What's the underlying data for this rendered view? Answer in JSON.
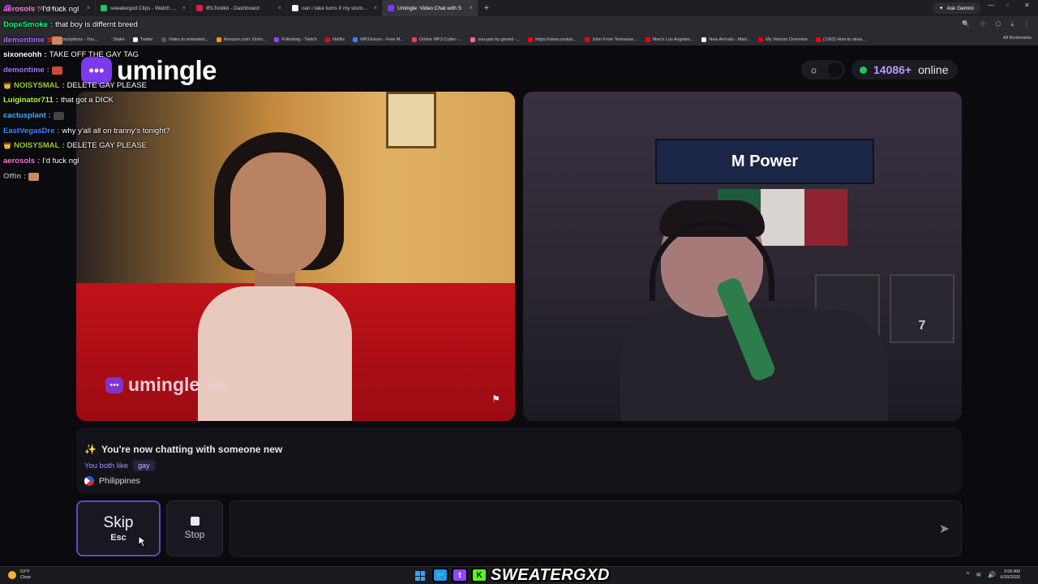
{
  "browser": {
    "tabs": [
      {
        "label": "aerosols: I'd fuck ngl",
        "color": "#9146ff"
      },
      {
        "label": "sweatergxd Clips - Watch Live o",
        "color": "#22c55e"
      },
      {
        "label": "IRLToolkit - Dashboard",
        "color": "#e11d48"
      },
      {
        "label": "can i take tums if my stummy h",
        "color": "#ffffff"
      },
      {
        "label": "Umingle: Video Chat with S",
        "color": "#7c3aed"
      }
    ],
    "new_tab": "+",
    "ask_gemini": "Ask Gemini",
    "bookmarks": [
      {
        "label": "Subscriptions - You...",
        "color": "#ff0000"
      },
      {
        "label": "Stake",
        "color": "#1a2c38"
      },
      {
        "label": "Twitter",
        "color": "#ffffff"
      },
      {
        "label": "Video to animated...",
        "color": "#555555"
      },
      {
        "label": "Amazon.com: Onlin...",
        "color": "#ff9900"
      },
      {
        "label": "Following - Twitch",
        "color": "#9146ff"
      },
      {
        "label": "Netflix",
        "color": "#e50914"
      },
      {
        "label": "MP3Juices - Free M...",
        "color": "#3b82f6"
      },
      {
        "label": "Online MP3 Cutter -...",
        "color": "#ef4444"
      },
      {
        "label": "osu-pps by grumd -...",
        "color": "#ff66aa"
      },
      {
        "label": "https://www.youtub...",
        "color": "#ff0000"
      },
      {
        "label": "John From Tennesse...",
        "color": "#ff0000"
      },
      {
        "label": "Men's Los Angeles...",
        "color": "#ff0000"
      },
      {
        "label": "New Arrivals - Mad...",
        "color": "#ffffff"
      },
      {
        "label": "My Verizon Overview",
        "color": "#ee0000"
      },
      {
        "label": "(1363) How to strea...",
        "color": "#ff0000"
      }
    ],
    "all_bookmarks": "All Bookmarks"
  },
  "stream_chat": [
    {
      "user": "aerosols",
      "user_color": "#ff7ad9",
      "message": "I'd fuck ngl",
      "badge": ""
    },
    {
      "user": "DopeSmoke",
      "user_color": "#00ff7f",
      "message": "that boy is differnt breed",
      "badge": ""
    },
    {
      "user": "demontime",
      "user_color": "#b070ff",
      "message": "",
      "badge": ""
    },
    {
      "user": "sixoneohh",
      "user_color": "#ffffff",
      "message": "TAKE OFF THE GAY TAG",
      "badge": ""
    },
    {
      "user": "demontime",
      "user_color": "#b070ff",
      "message": "",
      "badge": ""
    },
    {
      "user": "NOISYSMAL",
      "user_color": "#9acd32",
      "message": "DELETE GAY PLEASE",
      "badge": "👑"
    },
    {
      "user": "Luiginator711",
      "user_color": "#adff2f",
      "message": "that got a DICK",
      "badge": ""
    },
    {
      "user": "cactusplant",
      "user_color": "#3cb4ff",
      "message": "",
      "badge": ""
    },
    {
      "user": "EastVegasDre",
      "user_color": "#3c8cff",
      "message": "why y'all all on tranny's tonight?",
      "badge": ""
    },
    {
      "user": "NOISYSMAL",
      "user_color": "#9acd32",
      "message": "DELETE GAY PLEASE",
      "badge": "👑"
    },
    {
      "user": "aerosols",
      "user_color": "#ff7ad9",
      "message": "I'd fuck ngl",
      "badge": ""
    },
    {
      "user": "Offin",
      "user_color": "#a0a0a0",
      "message": "",
      "badge": ""
    }
  ],
  "app": {
    "logo_text": "umingle",
    "online_count": "14086+",
    "online_label": "online",
    "watermark_text": "umingle",
    "watermark_domain": ".com",
    "right_video_banner": "M Power"
  },
  "chat": {
    "system_message": "You're now chatting with someone new",
    "likes_label": "You both like",
    "likes_tag": "gay",
    "country": "Philippines"
  },
  "controls": {
    "skip_label": "Skip",
    "skip_key": "Esc",
    "stop_label": "Stop",
    "message_placeholder": ""
  },
  "taskbar": {
    "weather_temp": "63°F",
    "weather_cond": "Clear",
    "streamer_name": "SWEATERGXD",
    "time": "3:05 AM",
    "date": "6/28/2026"
  }
}
